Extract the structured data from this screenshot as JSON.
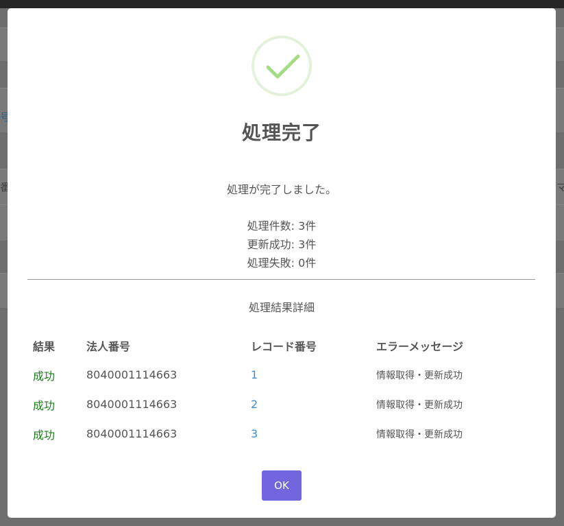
{
  "background": {
    "fragments": [
      "号",
      "番号",
      "マ"
    ]
  },
  "dialog": {
    "title": "処理完了",
    "icon": "check-icon",
    "accent_color": "#a5dc86",
    "message": "処理が完了しました。",
    "summary": {
      "processed": "処理件数: 3件",
      "succeeded": "更新成功: 3件",
      "failed": "処理失敗: 0件"
    },
    "details_title": "処理結果詳細",
    "table": {
      "headers": [
        "結果",
        "法人番号",
        "レコード番号",
        "エラーメッセージ"
      ],
      "rows": [
        {
          "result": "成功",
          "corp_number": "8040001114663",
          "record": "1",
          "message": "情報取得・更新成功"
        },
        {
          "result": "成功",
          "corp_number": "8040001114663",
          "record": "2",
          "message": "情報取得・更新成功"
        },
        {
          "result": "成功",
          "corp_number": "8040001114663",
          "record": "3",
          "message": "情報取得・更新成功"
        }
      ]
    },
    "ok_label": "OK",
    "ok_color": "#7166dd"
  }
}
